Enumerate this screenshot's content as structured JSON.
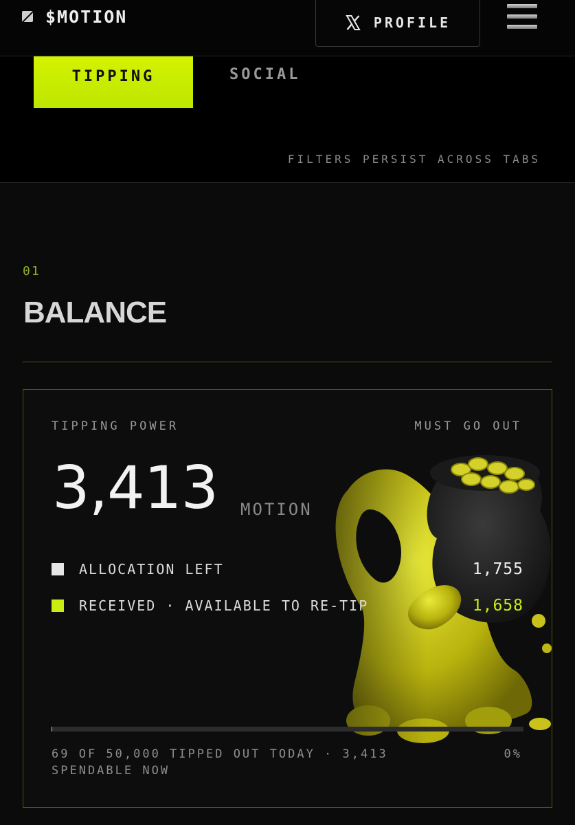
{
  "header": {
    "brand": "$MOTION",
    "brand_icon": "motion-logo-icon",
    "profile_icon": "x-logo-icon",
    "profile_label": "PROFILE",
    "menu_icon": "hamburger-menu-icon"
  },
  "tabs": [
    {
      "label": "TIPPING",
      "active": true
    },
    {
      "label": "SOCIAL",
      "active": false
    }
  ],
  "filters_note": "FILTERS PERSIST ACROSS TABS",
  "section": {
    "number": "01",
    "title": "BALANCE"
  },
  "balance": {
    "label_left": "TIPPING POWER",
    "label_right": "MUST GO OUT",
    "amount": "3,413",
    "unit": "MOTION",
    "rows": [
      {
        "label": "ALLOCATION LEFT",
        "value": "1,755",
        "swatch_color": "#e6e6e6"
      },
      {
        "label": "RECEIVED · AVAILABLE TO RE-TIP",
        "value": "1,658",
        "swatch_color": "#c9ef12"
      }
    ],
    "progress": {
      "text": "69 OF 50,000 TIPPED OUT TODAY · 3,413 SPENDABLE NOW",
      "percent_label": "0%",
      "fraction": 0.0014
    }
  },
  "colors": {
    "accent": "#c9ef12",
    "background": "#0b0b0b",
    "card_border": "#4a5614"
  }
}
